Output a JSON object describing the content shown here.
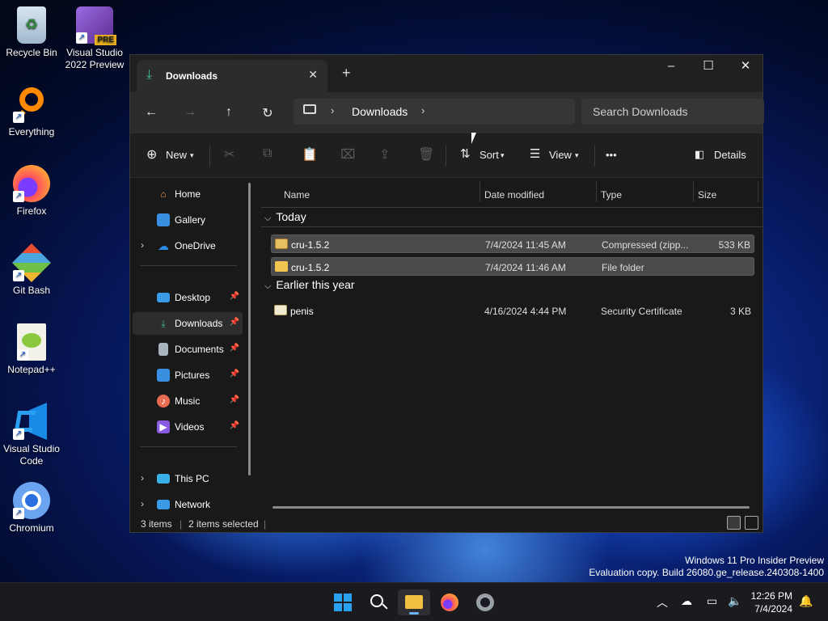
{
  "desktop": {
    "icons": [
      {
        "label": "Recycle Bin",
        "icon": "recycle-bin-icon"
      },
      {
        "label": "Visual Studio 2022 Preview",
        "icon": "visual-studio-icon",
        "badge": "PRE"
      },
      {
        "label": "Everything",
        "icon": "everything-search-icon"
      },
      {
        "label": "Firefox",
        "icon": "firefox-icon"
      },
      {
        "label": "Git Bash",
        "icon": "git-bash-icon"
      },
      {
        "label": "Notepad++",
        "icon": "notepad-plus-plus-icon"
      },
      {
        "label": "Visual Studio Code",
        "icon": "vscode-icon"
      },
      {
        "label": "Chromium",
        "icon": "chromium-icon"
      }
    ]
  },
  "window": {
    "tab_title": "Downloads",
    "new_tab": "+",
    "controls": {
      "minimize": "–",
      "maximize": "☐",
      "close": "✕"
    },
    "nav": {
      "back": "←",
      "forward": "→",
      "up": "↑",
      "refresh": "↻"
    },
    "address": {
      "crumb": "Downloads"
    },
    "search": {
      "placeholder": "Search Downloads"
    },
    "commands": {
      "new_label": "New",
      "sort_label": "Sort",
      "view_label": "View",
      "more_label": "•••",
      "details_label": "Details"
    },
    "sidebar": {
      "items": [
        {
          "label": "Home"
        },
        {
          "label": "Gallery"
        },
        {
          "label": "OneDrive"
        },
        {
          "label": "Desktop"
        },
        {
          "label": "Downloads"
        },
        {
          "label": "Documents"
        },
        {
          "label": "Pictures"
        },
        {
          "label": "Music"
        },
        {
          "label": "Videos"
        },
        {
          "label": "This PC"
        },
        {
          "label": "Network"
        }
      ]
    },
    "columns": {
      "name": "Name",
      "date": "Date modified",
      "type": "Type",
      "size": "Size"
    },
    "groups": [
      {
        "label": "Today",
        "rows": [
          {
            "name": "cru-1.5.2",
            "date": "7/4/2024 11:45 AM",
            "type": "Compressed (zipp...",
            "size": "533 KB"
          },
          {
            "name": "cru-1.5.2",
            "date": "7/4/2024 11:46 AM",
            "type": "File folder",
            "size": ""
          }
        ]
      },
      {
        "label": "Earlier this year",
        "rows": [
          {
            "name": "penis",
            "date": "4/16/2024 4:44 PM",
            "type": "Security Certificate",
            "size": "3 KB"
          }
        ]
      }
    ],
    "status": {
      "items": "3 items",
      "selected": "2 items selected"
    }
  },
  "watermark": {
    "line1": "Windows 11 Pro Insider Preview",
    "line2": "Evaluation copy. Build 26080.ge_release.240308-1400"
  },
  "taskbar": {
    "clock": {
      "time": "12:26 PM",
      "date": "7/4/2024"
    }
  }
}
